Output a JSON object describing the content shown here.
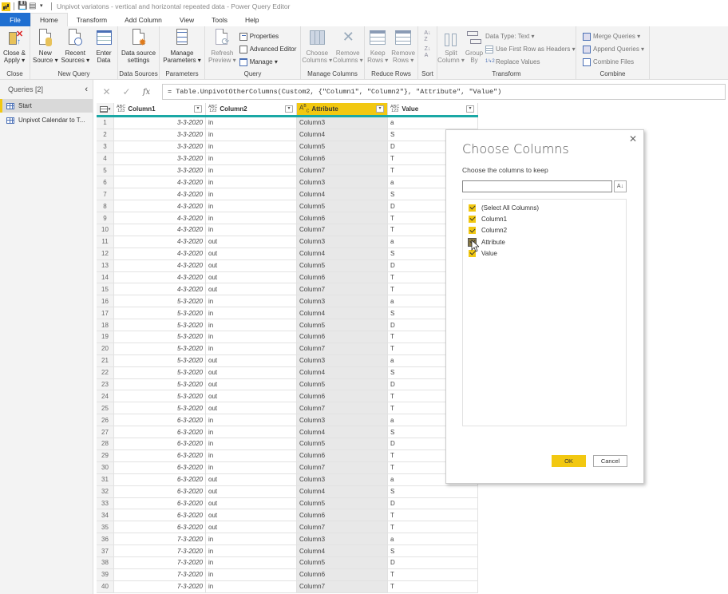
{
  "titlebar": {
    "title": "Unpivot variatons  - vertical and horizontal repeated data - Power Query Editor"
  },
  "menu_tabs": [
    {
      "label": "File"
    },
    {
      "label": "Home"
    },
    {
      "label": "Transform"
    },
    {
      "label": "Add Column"
    },
    {
      "label": "View"
    },
    {
      "label": "Tools"
    },
    {
      "label": "Help"
    }
  ],
  "ribbon": {
    "close": {
      "label": "Close",
      "close_apply": "Close &\nApply ▾"
    },
    "new_query": {
      "label": "New Query",
      "new_source": "New\nSource ▾",
      "recent_sources": "Recent\nSources ▾",
      "enter_data": "Enter\nData"
    },
    "data_sources": {
      "label": "Data Sources",
      "settings": "Data source\nsettings"
    },
    "parameters": {
      "label": "Parameters",
      "manage": "Manage\nParameters ▾"
    },
    "query": {
      "label": "Query",
      "refresh": "Refresh\nPreview ▾",
      "properties": "Properties",
      "advanced_editor": "Advanced Editor",
      "manage": "Manage ▾"
    },
    "manage_columns": {
      "label": "Manage Columns",
      "choose": "Choose\nColumns ▾",
      "remove": "Remove\nColumns ▾"
    },
    "reduce_rows": {
      "label": "Reduce Rows",
      "keep": "Keep\nRows ▾",
      "remove": "Remove\nRows ▾"
    },
    "sort": {
      "label": "Sort"
    },
    "transform": {
      "label": "Transform",
      "split": "Split\nColumn ▾",
      "group": "Group\nBy",
      "data_type": "Data Type: Text ▾",
      "first_row": "Use First Row as Headers ▾",
      "replace": "Replace Values"
    },
    "combine": {
      "label": "Combine",
      "merge": "Merge Queries ▾",
      "append": "Append Queries ▾",
      "files": "Combine Files"
    }
  },
  "queries_pane": {
    "header": "Queries [2]",
    "items": [
      {
        "label": "Start",
        "selected": true
      },
      {
        "label": "Unpivot Calendar to T...",
        "selected": false
      }
    ]
  },
  "formula_bar": {
    "formula": "= Table.UnpivotOtherColumns(Custom2, {\"Column1\", \"Column2\"}, \"Attribute\", \"Value\")"
  },
  "grid": {
    "columns": [
      {
        "name": "Column1",
        "type": "ABC\n123"
      },
      {
        "name": "Column2",
        "type": "ABC\n123"
      },
      {
        "name": "Attribute",
        "type": "A B C",
        "selected": true
      },
      {
        "name": "Value",
        "type": "ABC\n123"
      }
    ],
    "rows": [
      [
        "1",
        "3-3-2020",
        "in",
        "Column3",
        "a"
      ],
      [
        "2",
        "3-3-2020",
        "in",
        "Column4",
        "S"
      ],
      [
        "3",
        "3-3-2020",
        "in",
        "Column5",
        "D"
      ],
      [
        "4",
        "3-3-2020",
        "in",
        "Column6",
        "T"
      ],
      [
        "5",
        "3-3-2020",
        "in",
        "Column7",
        "T"
      ],
      [
        "6",
        "4-3-2020",
        "in",
        "Column3",
        "a"
      ],
      [
        "7",
        "4-3-2020",
        "in",
        "Column4",
        "S"
      ],
      [
        "8",
        "4-3-2020",
        "in",
        "Column5",
        "D"
      ],
      [
        "9",
        "4-3-2020",
        "in",
        "Column6",
        "T"
      ],
      [
        "10",
        "4-3-2020",
        "in",
        "Column7",
        "T"
      ],
      [
        "11",
        "4-3-2020",
        "out",
        "Column3",
        "a"
      ],
      [
        "12",
        "4-3-2020",
        "out",
        "Column4",
        "S"
      ],
      [
        "13",
        "4-3-2020",
        "out",
        "Column5",
        "D"
      ],
      [
        "14",
        "4-3-2020",
        "out",
        "Column6",
        "T"
      ],
      [
        "15",
        "4-3-2020",
        "out",
        "Column7",
        "T"
      ],
      [
        "16",
        "5-3-2020",
        "in",
        "Column3",
        "a"
      ],
      [
        "17",
        "5-3-2020",
        "in",
        "Column4",
        "S"
      ],
      [
        "18",
        "5-3-2020",
        "in",
        "Column5",
        "D"
      ],
      [
        "19",
        "5-3-2020",
        "in",
        "Column6",
        "T"
      ],
      [
        "20",
        "5-3-2020",
        "in",
        "Column7",
        "T"
      ],
      [
        "21",
        "5-3-2020",
        "out",
        "Column3",
        "a"
      ],
      [
        "22",
        "5-3-2020",
        "out",
        "Column4",
        "S"
      ],
      [
        "23",
        "5-3-2020",
        "out",
        "Column5",
        "D"
      ],
      [
        "24",
        "5-3-2020",
        "out",
        "Column6",
        "T"
      ],
      [
        "25",
        "5-3-2020",
        "out",
        "Column7",
        "T"
      ],
      [
        "26",
        "6-3-2020",
        "in",
        "Column3",
        "a"
      ],
      [
        "27",
        "6-3-2020",
        "in",
        "Column4",
        "S"
      ],
      [
        "28",
        "6-3-2020",
        "in",
        "Column5",
        "D"
      ],
      [
        "29",
        "6-3-2020",
        "in",
        "Column6",
        "T"
      ],
      [
        "30",
        "6-3-2020",
        "in",
        "Column7",
        "T"
      ],
      [
        "31",
        "6-3-2020",
        "out",
        "Column3",
        "a"
      ],
      [
        "32",
        "6-3-2020",
        "out",
        "Column4",
        "S"
      ],
      [
        "33",
        "6-3-2020",
        "out",
        "Column5",
        "D"
      ],
      [
        "34",
        "6-3-2020",
        "out",
        "Column6",
        "T"
      ],
      [
        "35",
        "6-3-2020",
        "out",
        "Column7",
        "T"
      ],
      [
        "36",
        "7-3-2020",
        "in",
        "Column3",
        "a"
      ],
      [
        "37",
        "7-3-2020",
        "in",
        "Column4",
        "S"
      ],
      [
        "38",
        "7-3-2020",
        "in",
        "Column5",
        "D"
      ],
      [
        "39",
        "7-3-2020",
        "in",
        "Column6",
        "T"
      ],
      [
        "40",
        "7-3-2020",
        "in",
        "Column7",
        "T"
      ]
    ]
  },
  "dialog": {
    "title": "Choose Columns",
    "subtitle": "Choose the columns to keep",
    "search_value": "",
    "sort_icon": "A↓Z",
    "options": [
      {
        "label": "(Select All Columns)",
        "checked": true
      },
      {
        "label": "Column1",
        "checked": true
      },
      {
        "label": "Column2",
        "checked": true
      },
      {
        "label": "Attribute",
        "checked": true,
        "hovered": true
      },
      {
        "label": "Value",
        "checked": true
      }
    ],
    "ok_label": "OK",
    "cancel_label": "Cancel"
  },
  "colors": {
    "accent": "#f2c811",
    "file_tab": "#1f6fd1",
    "header_underline": "#1aa8a5"
  }
}
